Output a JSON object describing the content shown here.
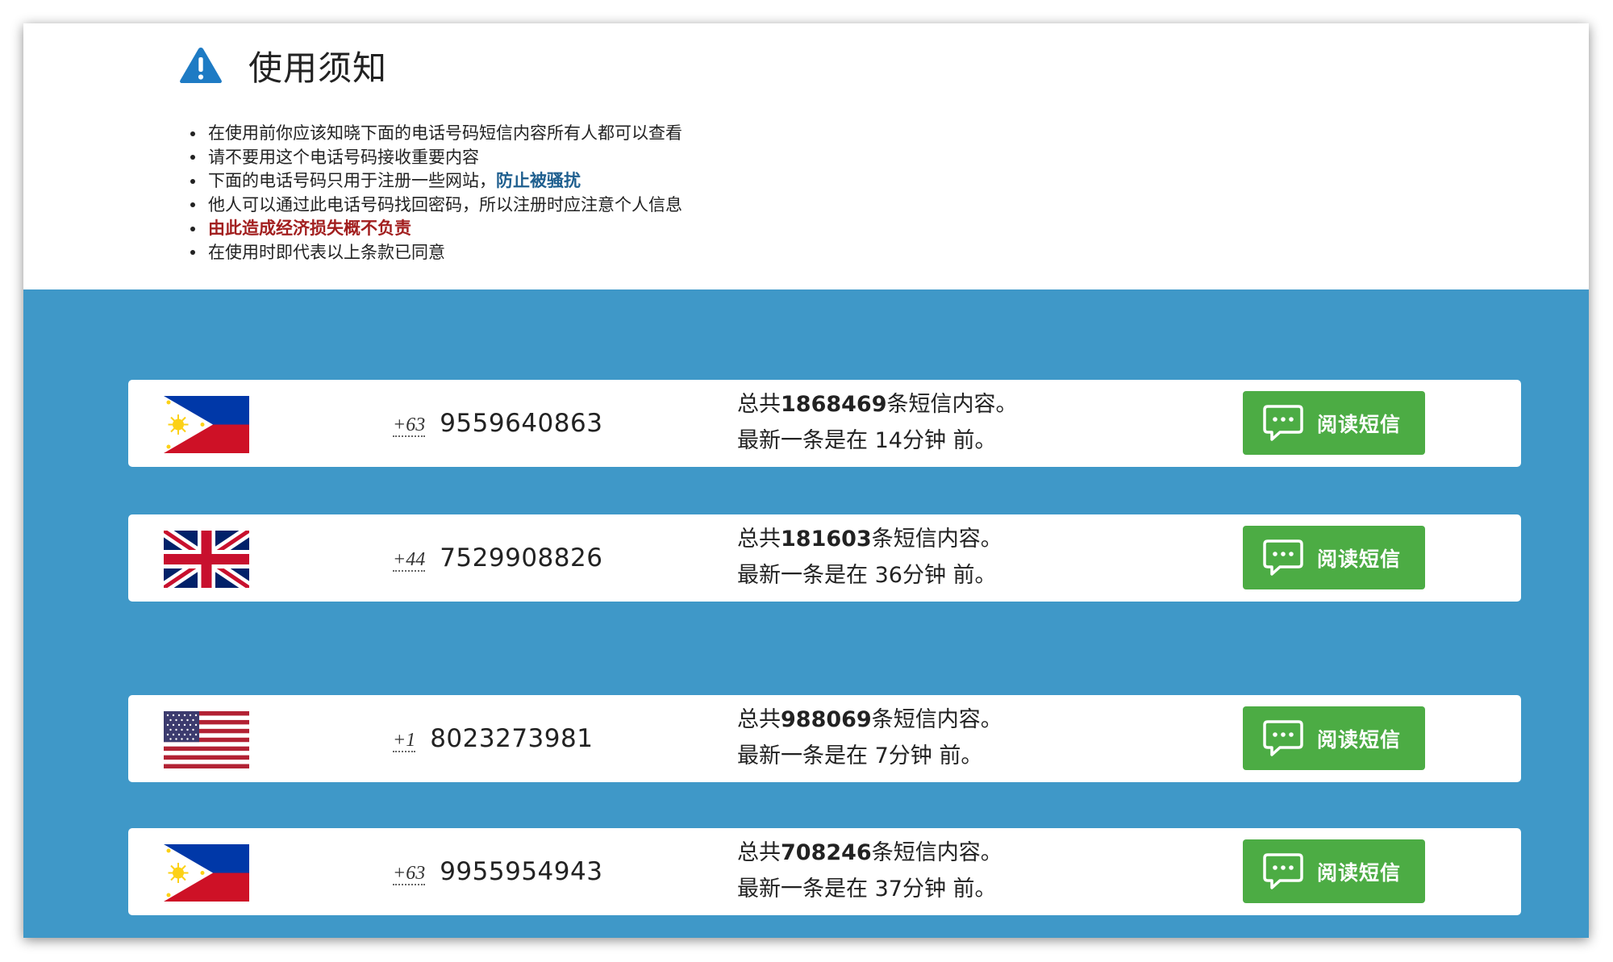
{
  "notice": {
    "title": "使用须知",
    "rules": [
      {
        "text": "在使用前你应该知晓下面的电话号码短信内容所有人都可以查看",
        "link": ""
      },
      {
        "text": "请不要用这个电话号码接收重要内容",
        "link": ""
      },
      {
        "text": "下面的电话号码只用于注册一些网站，",
        "link": "防止被骚扰"
      },
      {
        "text": "他人可以通过此电话号码找回密码，所以注册时应注意个人信息",
        "link": ""
      },
      {
        "text": "",
        "warning": "由此造成经济损失概不负责"
      },
      {
        "text": "在使用时即代表以上条款已同意",
        "link": ""
      }
    ],
    "colors": {
      "link": "#1f5f8f",
      "warning": "#a21f1f",
      "icon": "#1e7bc4"
    }
  },
  "phones": [
    {
      "flag": "philippines-flag",
      "country_code": "+63",
      "number": "9559640863",
      "total_prefix": "总共",
      "total": "1868469",
      "total_suffix": "条短信内容。",
      "latest_prefix": "最新一条是在",
      "latest_time": "14分钟",
      "latest_suffix": "前。",
      "button_label": "阅读短信"
    },
    {
      "flag": "uk-flag",
      "country_code": "+44",
      "number": "7529908826",
      "total_prefix": "总共",
      "total": "181603",
      "total_suffix": "条短信内容。",
      "latest_prefix": "最新一条是在",
      "latest_time": "36分钟",
      "latest_suffix": "前。",
      "button_label": "阅读短信"
    },
    {
      "flag": "usa-flag",
      "country_code": "+1",
      "number": "8023273981",
      "total_prefix": "总共",
      "total": "988069",
      "total_suffix": "条短信内容。",
      "latest_prefix": "最新一条是在",
      "latest_time": "7分钟",
      "latest_suffix": "前。",
      "button_label": "阅读短信"
    },
    {
      "flag": "philippines-flag",
      "country_code": "+63",
      "number": "9955954943",
      "total_prefix": "总共",
      "total": "708246",
      "total_suffix": "条短信内容。",
      "latest_prefix": "最新一条是在",
      "latest_time": "37分钟",
      "latest_suffix": "前。",
      "button_label": "阅读短信"
    }
  ],
  "theme": {
    "section_bg": "#3f98c8",
    "button_bg": "#4cac44",
    "button_text": "#ffffff"
  }
}
